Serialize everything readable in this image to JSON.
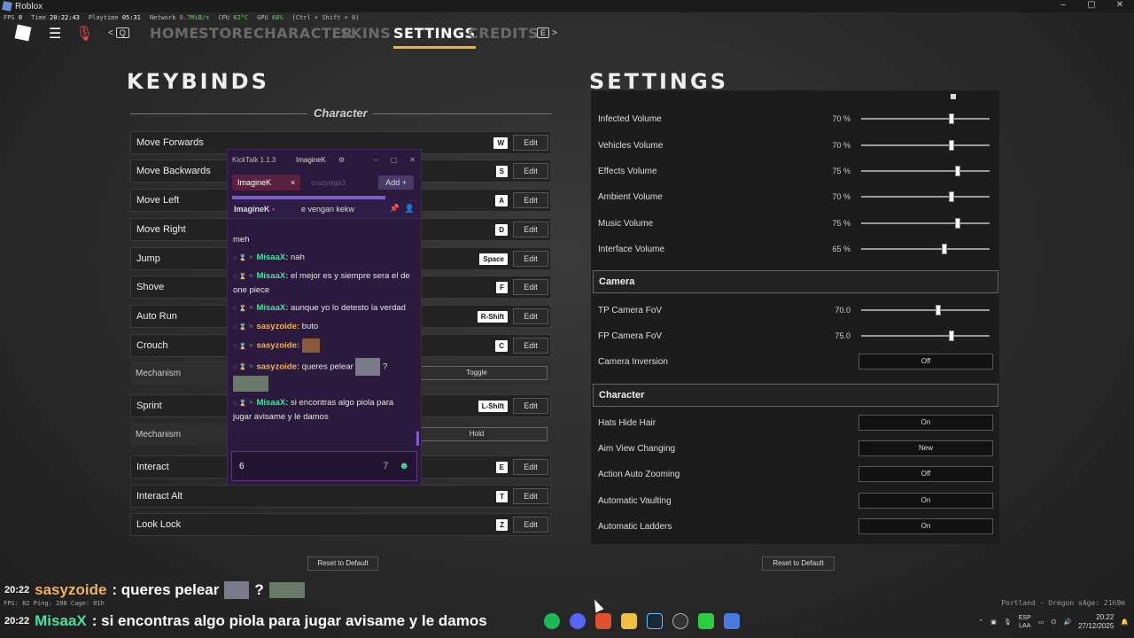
{
  "window": {
    "title": "Roblox",
    "minimize": "–",
    "maximize": "▢",
    "close": "✕"
  },
  "stats": {
    "fps_label": "FPS",
    "fps": "0",
    "time_label": "Time",
    "time": "20:22:43",
    "playtime_label": "Playtime",
    "playtime": "05:31",
    "network_label": "Network",
    "network": "0.7MiB/s",
    "cpu_label": "CPU",
    "cpu": "62°C",
    "gpu_label": "GPU",
    "gpu": "68%",
    "hint": "(Ctrl + Shift + 0)"
  },
  "nav": {
    "left_key": "Q",
    "right_key": "E",
    "tabs": [
      "HOME",
      "STORE",
      "CHARACTER",
      "SKINS",
      "SETTINGS",
      "CREDITS"
    ],
    "active_tab": "SETTINGS"
  },
  "keybinds": {
    "title": "KEYBINDS",
    "section": "Character",
    "edit_label": "Edit",
    "rows": [
      {
        "label": "Move Forwards",
        "key": "W"
      },
      {
        "label": "Move Backwards",
        "key": "S"
      },
      {
        "label": "Move Left",
        "key": "A"
      },
      {
        "label": "Move Right",
        "key": "D"
      },
      {
        "label": "Jump",
        "key": "Space"
      },
      {
        "label": "Shove",
        "key": "F"
      },
      {
        "label": "Auto Run",
        "key": "R-Shift"
      },
      {
        "label": "Crouch",
        "key": "C"
      }
    ],
    "crouch_mechanism": {
      "label": "Mechanism",
      "value": "Toggle"
    },
    "sprint": {
      "label": "Sprint",
      "key": "L-Shift"
    },
    "sprint_mechanism": {
      "label": "Mechanism",
      "value": "Hold"
    },
    "rows2": [
      {
        "label": "Interact",
        "key": "E"
      },
      {
        "label": "Interact Alt",
        "key": "T"
      },
      {
        "label": "Look Lock",
        "key": "Z"
      }
    ],
    "reset_label": "Reset to Default"
  },
  "settings": {
    "title": "SETTINGS",
    "volumes": [
      {
        "label": "Infected Volume",
        "value": "70 %",
        "level": 0.7
      },
      {
        "label": "Vehicles Volume",
        "value": "70 %",
        "level": 0.7
      },
      {
        "label": "Effects Volume",
        "value": "75 %",
        "level": 0.75
      },
      {
        "label": "Ambient Volume",
        "value": "70 %",
        "level": 0.7
      },
      {
        "label": "Music Volume",
        "value": "75 %",
        "level": 0.75
      },
      {
        "label": "Interface Volume",
        "value": "65 %",
        "level": 0.65
      }
    ],
    "camera_header": "Camera",
    "camera": [
      {
        "label": "TP Camera FoV",
        "value": "70.0",
        "level": 0.6
      },
      {
        "label": "FP Camera FoV",
        "value": "75.0",
        "level": 0.7
      }
    ],
    "camera_inversion": {
      "label": "Camera Inversion",
      "value": "Off"
    },
    "character_header": "Character",
    "character": [
      {
        "label": "Hats Hide Hair",
        "value": "On"
      },
      {
        "label": "Aim View Changing",
        "value": "New"
      },
      {
        "label": "Action Auto Zooming",
        "value": "Off"
      },
      {
        "label": "Automatic Vaulting",
        "value": "On"
      },
      {
        "label": "Automatic Ladders",
        "value": "On"
      }
    ],
    "reset_label": "Reset to Default"
  },
  "chat": {
    "app": "KickTalk 1.1.3",
    "user": "ImagineK",
    "tab_active": "ImagineK",
    "tab_close": "×",
    "tab_inactive": "crazyniga3",
    "add_label": "Add",
    "pinned_user": "ImagineK",
    "pinned_text": "e vengan kekw",
    "partial_top": "meh",
    "messages": [
      {
        "user": "MisaaX:",
        "color": "green",
        "text": "nah"
      },
      {
        "user": "MisaaX:",
        "color": "green",
        "text": "el mejor es y siempre sera el de one piece"
      },
      {
        "user": "MisaaX:",
        "color": "green",
        "text": "aunque yo lo detesto la verdad"
      },
      {
        "user": "sasyzoide:",
        "color": "orange",
        "text": "buto"
      },
      {
        "user": "sasyzoide:",
        "color": "orange",
        "text": ""
      },
      {
        "user": "sasyzoide:",
        "color": "orange",
        "text": "queres pelear"
      },
      {
        "user": "MisaaX:",
        "color": "green",
        "text": "si encontras algo piola para jugar avisame y le damos"
      }
    ],
    "input_value": "6"
  },
  "overlay": {
    "msg1_time": "20:22",
    "msg1_user": "sasyzoide",
    "msg1_text": ": queres pelear",
    "msg1_q": "?",
    "msg2_time": "20:22",
    "msg2_user": "MisaaX",
    "msg2_text": ": si encontras algo piola para jugar avisame y le damos",
    "footer_stats": "FPS: 82  Ping: 208  Cage: 01h",
    "footer_right": "Portland - Oregon  sAge: 21h9m"
  },
  "taskbar": {
    "lang": "ESP",
    "region": "LAA",
    "time": "20:22",
    "date": "27/12/2025"
  },
  "colors": {
    "accent": "#d8b56a",
    "chat_bg": "#2b1a3e",
    "green_name": "#4ae0a0",
    "orange_name": "#f0b060"
  }
}
